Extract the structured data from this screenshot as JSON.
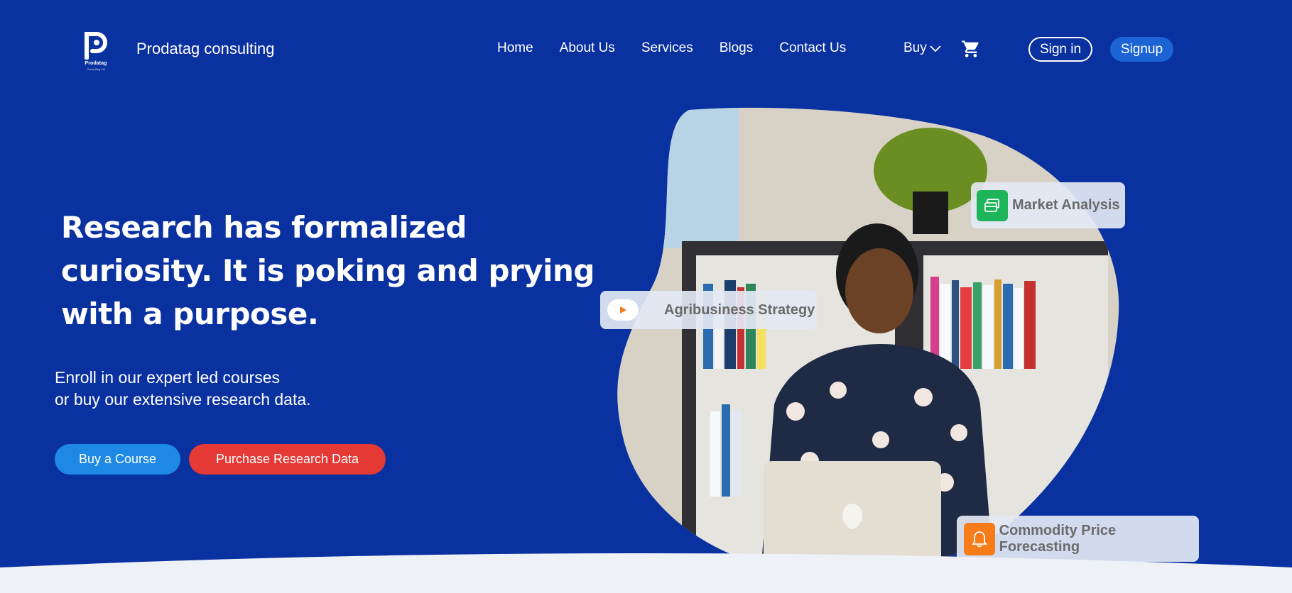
{
  "header": {
    "logo": {
      "text": "Prodatag",
      "sub": "Consulting Ltd"
    },
    "brand": "Prodatag consulting",
    "nav": [
      "Home",
      "About Us",
      "Services",
      "Blogs",
      "Contact Us"
    ],
    "buy_label": "Buy",
    "signin_label": "Sign in",
    "signup_label": "Signup"
  },
  "hero": {
    "headline_lines": [
      "Research has formalized",
      "curiosity. It is poking and prying",
      "with a purpose."
    ],
    "sub_lines": [
      "Enroll in our expert led courses",
      "or buy our extensive research data."
    ],
    "cta_course": "Buy a Course",
    "cta_data": "Purchase Research Data"
  },
  "cards": {
    "market": "Market Analysis",
    "agri": "Agribusiness Strategy",
    "commodity": "Commodity Price Forecasting"
  },
  "colors": {
    "background": "#0a31a0",
    "signup": "#1c63d4",
    "course_button": "#1e88e5",
    "data_button": "#e53935",
    "green_icon": "#1db45a",
    "orange_icon": "#f57c18"
  },
  "icons": [
    "prodatag-logo-icon",
    "chevron-down-icon",
    "shopping-cart-icon",
    "payment-card-icon",
    "play-icon",
    "bell-icon"
  ]
}
